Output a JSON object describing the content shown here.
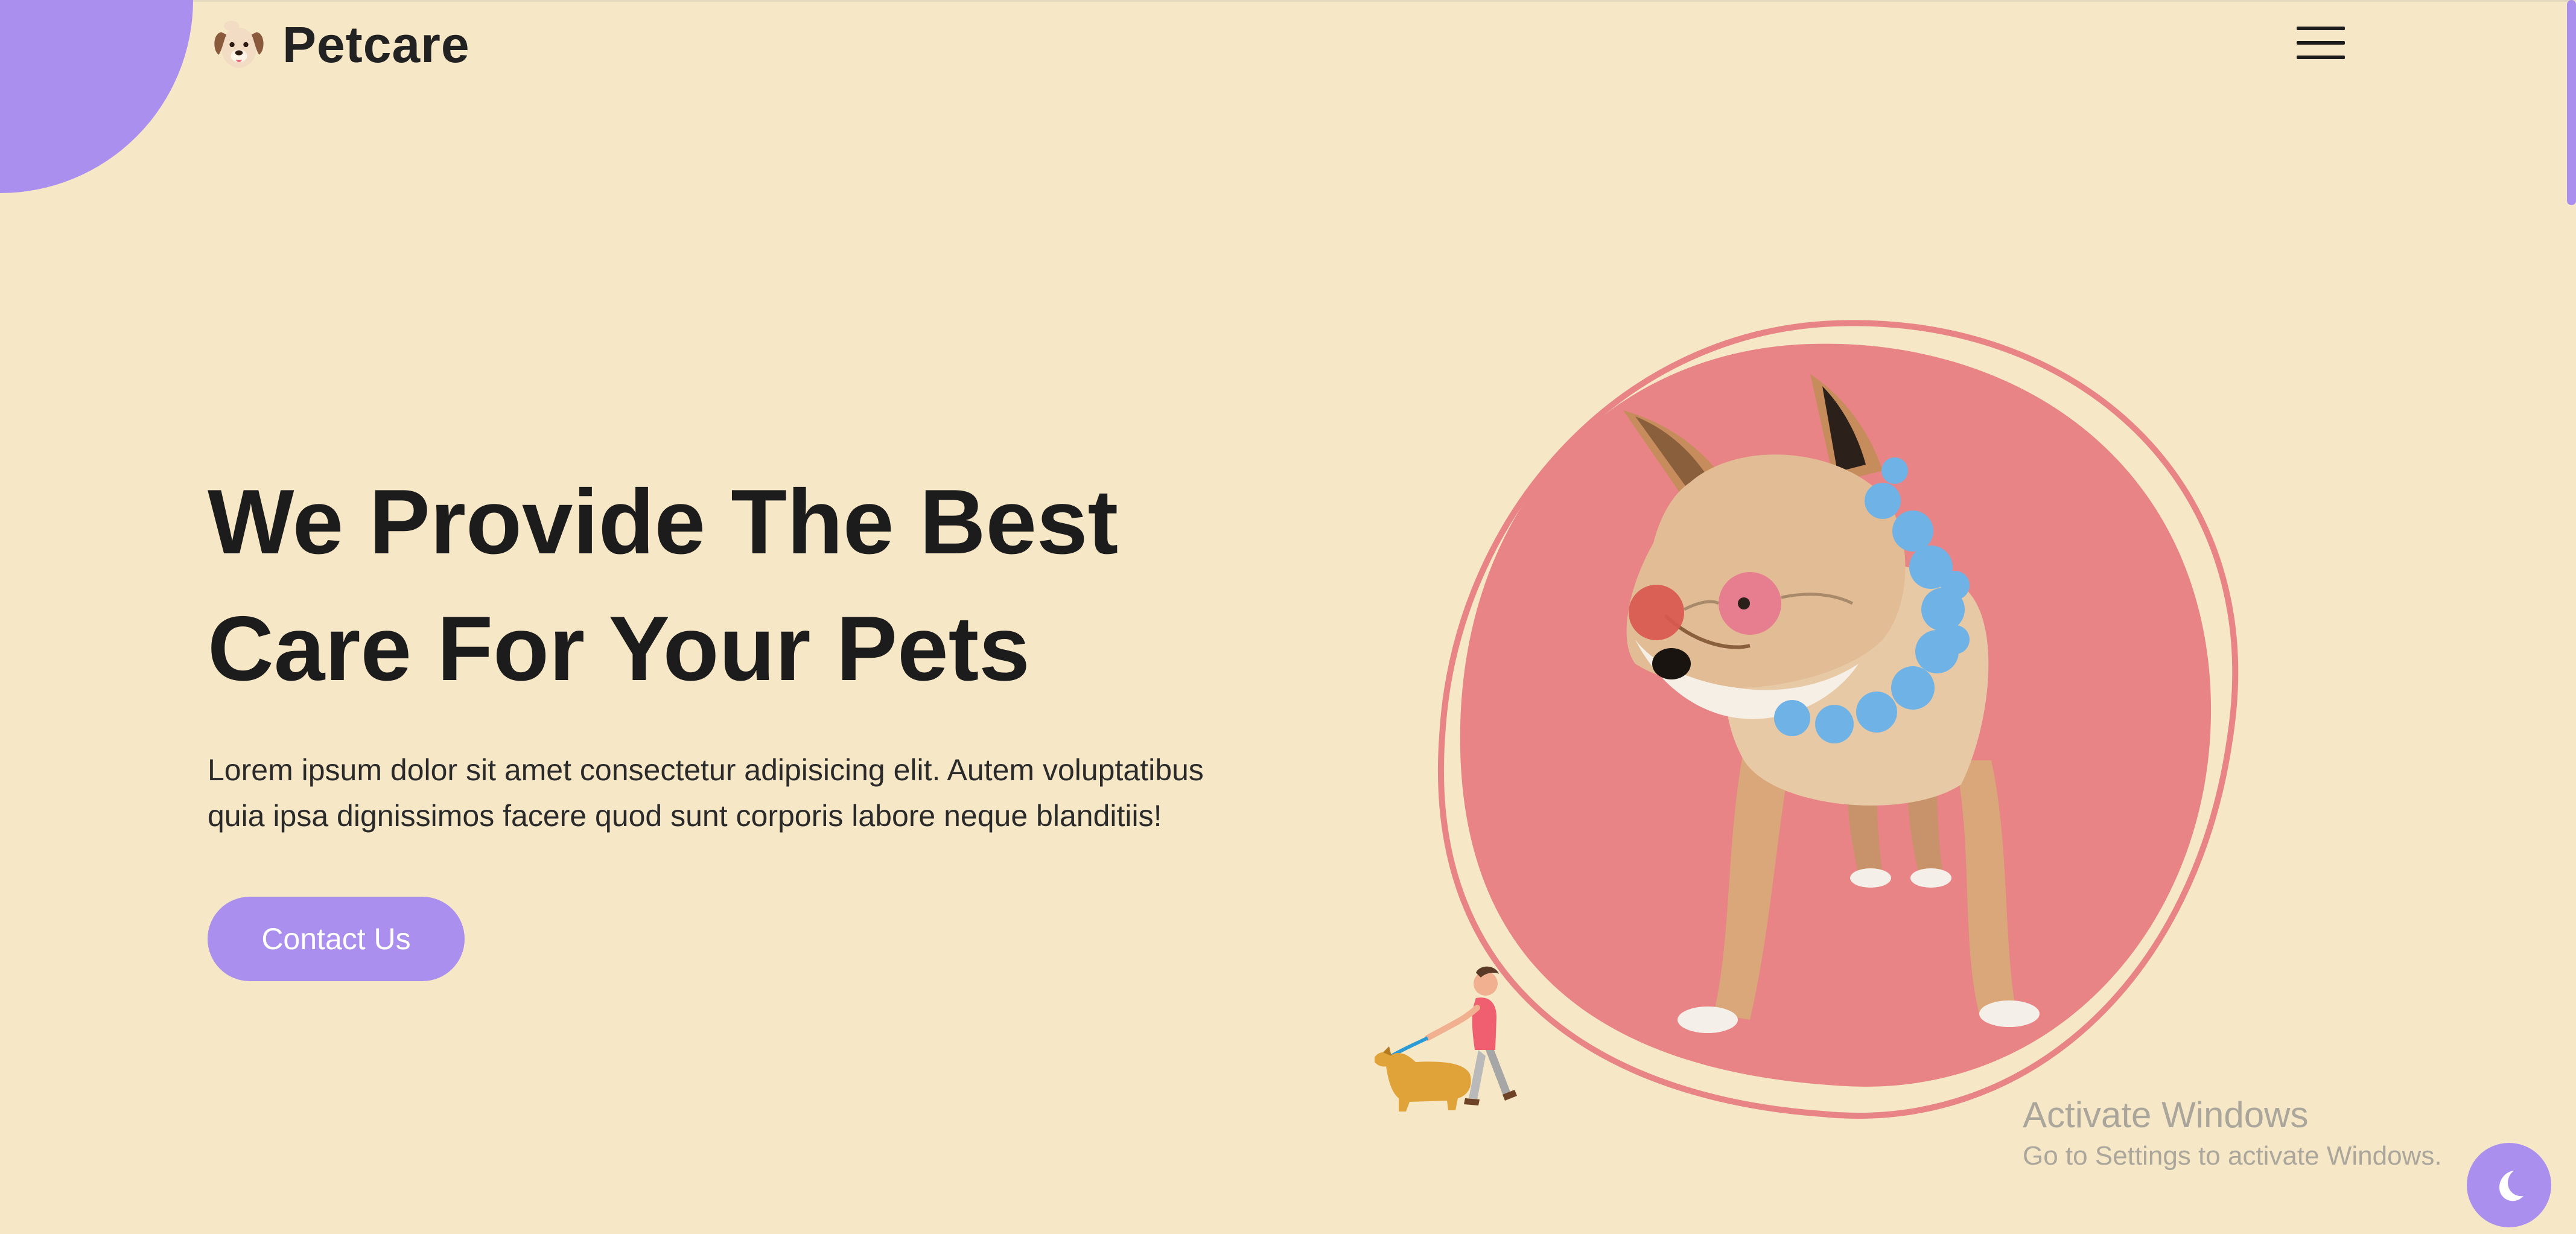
{
  "brand": {
    "name": "Petcare",
    "logo_icon": "dog-face-icon"
  },
  "header": {
    "menu_icon": "hamburger-menu-icon"
  },
  "hero": {
    "title_lines": [
      "We Provide The Best",
      "Care For Your Pets"
    ],
    "text_lines": [
      "Lorem ipsum dolor sit amet consectetur adipisicing elit. Autem voluptatibus",
      "quia ipsa dignissimos facere quod sunt corporis labore neque blanditiis!"
    ],
    "contact_label": "Contact Us",
    "illustration": "dog-with-sunglasses-image",
    "small_illustration": "person-walking-dog-illustration"
  },
  "watermark": {
    "title": "Activate Windows",
    "subtitle": "Go to Settings to activate Windows."
  },
  "theme_toggle": {
    "icon": "moon-icon"
  },
  "colors": {
    "background": "#f6e7c6",
    "accent": "#ab8fef",
    "blob": "#e88485",
    "text": "#1c1c1c"
  }
}
